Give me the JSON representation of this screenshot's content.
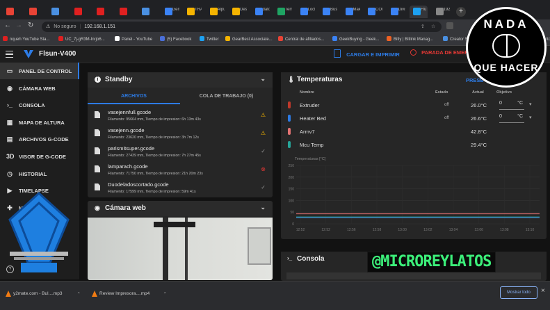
{
  "browser": {
    "tabs": [
      {
        "label": "",
        "color": "#e94335"
      },
      {
        "label": "",
        "color": "#e94335"
      },
      {
        "label": "",
        "color": "#4a90e2"
      },
      {
        "label": "",
        "color": "#e02020"
      },
      {
        "label": "",
        "color": "#e02020"
      },
      {
        "label": "",
        "color": "#e02020"
      },
      {
        "label": "",
        "color": "#4a90e2"
      },
      {
        "label": "Gem",
        "color": "#3b83f6"
      },
      {
        "label": "TRAI",
        "color": "#f5b400"
      },
      {
        "label": "Alpun",
        "color": "#f5b400"
      },
      {
        "label": "Desco",
        "color": "#f5b400"
      },
      {
        "label": "datos",
        "color": "#3b83f6"
      },
      {
        "label": "Tema",
        "color": "#1fa463"
      },
      {
        "label": "Lock",
        "color": "#3b83f6"
      },
      {
        "label": "Busq",
        "color": "#3b83f6"
      },
      {
        "label": "Makei",
        "color": "#3b83f6"
      },
      {
        "label": "CONI",
        "color": "#3b83f6"
      },
      {
        "label": "Divis",
        "color": "#3b83f6"
      },
      {
        "label": "Flu",
        "color": "#1da1f2"
      },
      {
        "label": "192.1",
        "color": "#888888"
      }
    ],
    "new_tab_glyph": "+",
    "security_label": "No seguro",
    "url": "192.168.1.151",
    "bookmarks": [
      {
        "label": "nqueh YouTube Sta...",
        "color": "#e02020"
      },
      {
        "label": "UC_7j-gR3M-Inrjo6...",
        "color": "#e02020"
      },
      {
        "label": "Panel - YouTube",
        "color": "#ffffff"
      },
      {
        "label": "(5) Facebook",
        "color": "#4a6fd8"
      },
      {
        "label": "Twitter",
        "color": "#1da1f2"
      },
      {
        "label": "GearBest Associate...",
        "color": "#f5b400"
      },
      {
        "label": "Central de afiliados...",
        "color": "#e94335"
      },
      {
        "label": "GeekBuying - Geek...",
        "color": "#3b83f6"
      },
      {
        "label": "Bitly | Bitlink Manag...",
        "color": "#ee6123"
      },
      {
        "label": "Creator Studio",
        "color": "#4a90e2"
      },
      {
        "label": "Otros favoritos",
        "color": "#f5b400"
      }
    ]
  },
  "app": {
    "title": "Flsun-V400",
    "upload_print_label": "CARGAR E IMPRIMIR",
    "emergency_stop_label": "PARADA DE EMERG",
    "accent": "#2d7be4",
    "danger": "#e53935"
  },
  "sidebar": {
    "items": [
      {
        "label": "PANEL DE CONTROL",
        "glyph": "▭"
      },
      {
        "label": "CÁMARA WEB",
        "glyph": "◉"
      },
      {
        "label": "CONSOLA",
        "glyph": "›_"
      },
      {
        "label": "MAPA DE ALTURA",
        "glyph": "▦"
      },
      {
        "label": "ARCHIVOS G-CODE",
        "glyph": "▤"
      },
      {
        "label": "VISOR DE G-CODE",
        "glyph": "3D"
      },
      {
        "label": "HISTORIAL",
        "glyph": "◷"
      },
      {
        "label": "TIMELAPSE",
        "glyph": "▶"
      },
      {
        "label": "MÁQUINA",
        "glyph": "✚"
      }
    ],
    "help_glyph": "?"
  },
  "status_panel": {
    "title": "Standby",
    "tabs": [
      "ARCHIVOS",
      "COLA DE TRABAJO (0)"
    ],
    "files": [
      {
        "name": "vasejennfull.gcode",
        "meta": "Filamento: 95664 mm, Tiempo de impresion: 6h 13m 43s",
        "status": "⚠",
        "status_color": "#f5b400"
      },
      {
        "name": "vasejenn.gcode",
        "meta": "Filamento: 23620 mm, Tiempo de impresion: 3h 7m 12s",
        "status": "⚠",
        "status_color": "#f5b400"
      },
      {
        "name": "parismitsuper.gcode",
        "meta": "Filamento: 27439 mm, Tiempo de impresion: 7h 27m 45s",
        "status": "✓",
        "status_color": "#9a9a9a"
      },
      {
        "name": "lamparach.gcode",
        "meta": "Filamento: 71750 mm, Tiempo de impresion: 21h 20m 23s",
        "status": "⊗",
        "status_color": "#e53935"
      },
      {
        "name": "Duodeladoscortado.gcode",
        "meta": "Filamento: 17599 mm, Tiempo de impresion: 59m 41s",
        "status": "✓",
        "status_color": "#9a9a9a"
      }
    ]
  },
  "webcam_panel": {
    "title": "Cámara web"
  },
  "temps_panel": {
    "title": "Temperaturas",
    "presets_label": "PRESE",
    "headers": {
      "name": "Nombre",
      "state": "Estado",
      "actual": "Actual",
      "target": "Objetivo"
    },
    "rows": [
      {
        "name": "Extruder",
        "state": "off",
        "actual": "26.0°C",
        "target": "0",
        "unit": "°C",
        "color": "#c0392b"
      },
      {
        "name": "Heater Bed",
        "state": "off",
        "actual": "26.6°C",
        "target": "0",
        "unit": "°C",
        "color": "#2d7be4"
      },
      {
        "name": "Armv7",
        "state": "",
        "actual": "42.8°C",
        "target": "",
        "unit": "",
        "color": "#e57373"
      },
      {
        "name": "Mcu Temp",
        "state": "",
        "actual": "29.4°C",
        "target": "",
        "unit": "",
        "color": "#26a69a"
      }
    ],
    "chart_ylabel": "Temperaturas [°C]",
    "y_ticks": [
      "250",
      "200",
      "150",
      "100",
      "50",
      "0"
    ],
    "x_ticks": [
      "12:52",
      "12:52",
      "12:56",
      "12:58",
      "13:00",
      "13:02",
      "13:04",
      "13:06",
      "13:08",
      "13:10"
    ]
  },
  "console_panel": {
    "title": "Consola"
  },
  "downloads": {
    "items": [
      {
        "label": "y2mate.com - Bul....mp3"
      },
      {
        "label": "Review Impresora....mp4"
      }
    ],
    "show_all_label": "Mostrar todo",
    "close_glyph": "×"
  },
  "overlay": {
    "logo_top": "NADA",
    "logo_bottom": "QUE HACER",
    "handle": "@MICROREYLATOS"
  }
}
